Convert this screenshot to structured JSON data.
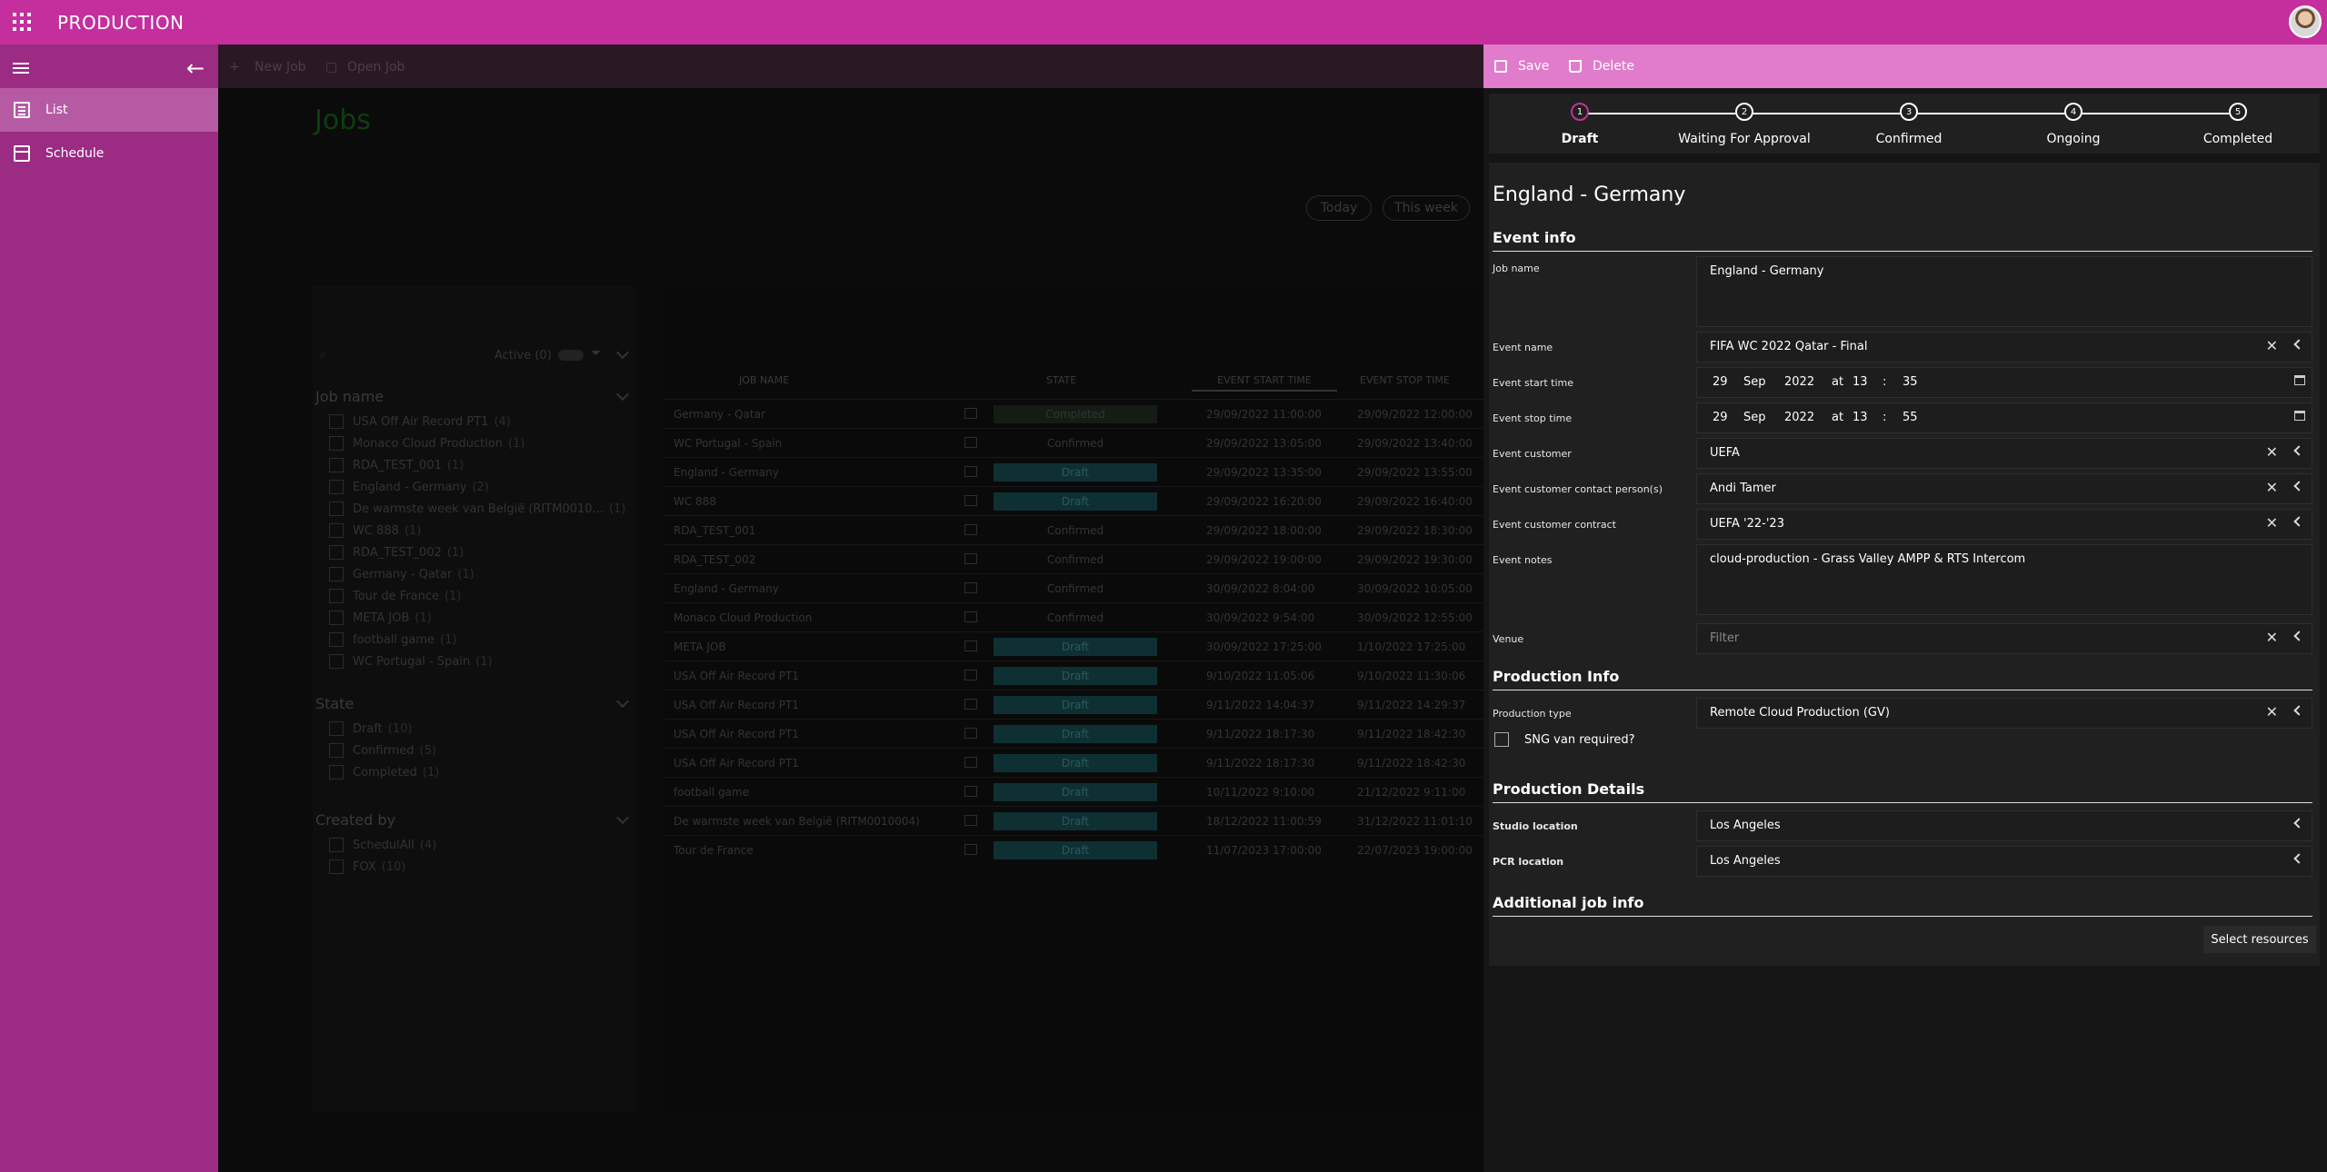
{
  "app": {
    "title": "PRODUCTION"
  },
  "sidebar": {
    "items": [
      {
        "label": "List",
        "icon": "list-icon",
        "active": true
      },
      {
        "label": "Schedule",
        "icon": "calendar-icon",
        "active": false
      }
    ]
  },
  "main": {
    "commands": {
      "new_job": "New Job",
      "open_job": "Open Job"
    },
    "title": "Jobs",
    "pills": {
      "today": "Today",
      "this_week": "This week"
    },
    "filters": {
      "active_label": "Active (0)",
      "groups": [
        {
          "title": "Job name",
          "items": [
            {
              "label": "USA Off Air Record PT1",
              "count": "(4)"
            },
            {
              "label": "Monaco Cloud Production",
              "count": "(1)"
            },
            {
              "label": "RDA_TEST_001",
              "count": "(1)"
            },
            {
              "label": "England - Germany",
              "count": "(2)"
            },
            {
              "label": "De warmste week van België (RITM0010...",
              "count": "(1)"
            },
            {
              "label": "WC 888",
              "count": "(1)"
            },
            {
              "label": "RDA_TEST_002",
              "count": "(1)"
            },
            {
              "label": "Germany - Qatar",
              "count": "(1)"
            },
            {
              "label": "Tour de France",
              "count": "(1)"
            },
            {
              "label": "META JOB",
              "count": "(1)"
            },
            {
              "label": "football game",
              "count": "(1)"
            },
            {
              "label": "WC Portugal - Spain",
              "count": "(1)"
            }
          ]
        },
        {
          "title": "State",
          "items": [
            {
              "label": "Draft",
              "count": "(10)"
            },
            {
              "label": "Confirmed",
              "count": "(5)"
            },
            {
              "label": "Completed",
              "count": "(1)"
            }
          ]
        },
        {
          "title": "Created by",
          "items": [
            {
              "label": "SchedulAll",
              "count": "(4)"
            },
            {
              "label": "FOX",
              "count": "(10)"
            }
          ]
        }
      ]
    },
    "grid": {
      "headers": {
        "job_name": "JOB NAME",
        "state": "STATE",
        "start": "EVENT START TIME",
        "stop": "EVENT STOP TIME"
      },
      "rows": [
        {
          "name": "Germany - Qatar",
          "state": "Completed",
          "start": "29/09/2022 11:00:00",
          "stop": "29/09/2022 12:00:00"
        },
        {
          "name": "WC Portugal - Spain",
          "state": "Confirmed",
          "start": "29/09/2022 13:05:00",
          "stop": "29/09/2022 13:40:00"
        },
        {
          "name": "England - Germany",
          "state": "Draft",
          "start": "29/09/2022 13:35:00",
          "stop": "29/09/2022 13:55:00"
        },
        {
          "name": "WC 888",
          "state": "Draft",
          "start": "29/09/2022 16:20:00",
          "stop": "29/09/2022 16:40:00"
        },
        {
          "name": "RDA_TEST_001",
          "state": "Confirmed",
          "start": "29/09/2022 18:00:00",
          "stop": "29/09/2022 18:30:00"
        },
        {
          "name": "RDA_TEST_002",
          "state": "Confirmed",
          "start": "29/09/2022 19:00:00",
          "stop": "29/09/2022 19:30:00"
        },
        {
          "name": "England - Germany",
          "state": "Confirmed",
          "start": "30/09/2022 8:04:00",
          "stop": "30/09/2022 10:05:00"
        },
        {
          "name": "Monaco Cloud Production",
          "state": "Confirmed",
          "start": "30/09/2022 9:54:00",
          "stop": "30/09/2022 12:55:00"
        },
        {
          "name": "META JOB",
          "state": "Draft",
          "start": "30/09/2022 17:25:00",
          "stop": "1/10/2022 17:25:00"
        },
        {
          "name": "USA Off Air Record PT1",
          "state": "Draft",
          "start": "9/10/2022 11:05:06",
          "stop": "9/10/2022 11:30:06"
        },
        {
          "name": "USA Off Air Record PT1",
          "state": "Draft",
          "start": "9/11/2022 14:04:37",
          "stop": "9/11/2022 14:29:37"
        },
        {
          "name": "USA Off Air Record PT1",
          "state": "Draft",
          "start": "9/11/2022 18:17:30",
          "stop": "9/11/2022 18:42:30"
        },
        {
          "name": "USA Off Air Record PT1",
          "state": "Draft",
          "start": "9/11/2022 18:17:30",
          "stop": "9/11/2022 18:42:30"
        },
        {
          "name": "football game",
          "state": "Draft",
          "start": "10/11/2022 9:10:00",
          "stop": "21/12/2022 9:11:00"
        },
        {
          "name": "De warmste week van België (RITM0010004)",
          "state": "Draft",
          "start": "18/12/2022 11:00:59",
          "stop": "31/12/2022 11:01:10"
        },
        {
          "name": "Tour de France",
          "state": "Draft",
          "start": "11/07/2023 17:00:00",
          "stop": "22/07/2023 19:00:00"
        }
      ]
    }
  },
  "panel": {
    "commands": {
      "save": "Save",
      "delete": "Delete"
    },
    "steps": [
      {
        "num": "1",
        "label": "Draft",
        "current": true
      },
      {
        "num": "2",
        "label": "Waiting For Approval"
      },
      {
        "num": "3",
        "label": "Confirmed"
      },
      {
        "num": "4",
        "label": "Ongoing"
      },
      {
        "num": "5",
        "label": "Completed"
      }
    ],
    "title": "England - Germany",
    "sections": {
      "event_info": "Event info",
      "production_info": "Production Info",
      "production_details": "Production Details",
      "additional": "Additional job info"
    },
    "fields": {
      "job_name": {
        "label": "Job name",
        "value": "England - Germany"
      },
      "event_name": {
        "label": "Event name",
        "value": "FIFA WC 2022 Qatar - Final"
      },
      "start": {
        "label": "Event start time",
        "day": "29",
        "month": "Sep",
        "year": "2022",
        "at": "at",
        "hour": "13",
        "sep": ":",
        "minute": "35"
      },
      "stop": {
        "label": "Event stop time",
        "day": "29",
        "month": "Sep",
        "year": "2022",
        "at": "at",
        "hour": "13",
        "sep": ":",
        "minute": "55"
      },
      "customer": {
        "label": "Event customer",
        "value": "UEFA"
      },
      "contact": {
        "label": "Event customer contact person(s)",
        "value": "Andi Tamer"
      },
      "contract": {
        "label": "Event customer contract",
        "value": "UEFA '22-'23"
      },
      "notes": {
        "label": "Event notes",
        "value": "cloud-production - Grass Valley AMPP & RTS Intercom"
      },
      "venue": {
        "label": "Venue",
        "placeholder": "Filter"
      },
      "production_type": {
        "label": "Production type",
        "value": "Remote Cloud Production (GV)"
      },
      "sng": {
        "label": "SNG van required?"
      },
      "studio": {
        "label": "Studio location",
        "value": "Los Angeles"
      },
      "pcr": {
        "label": "PCR location",
        "value": "Los Angeles"
      }
    },
    "select_resources": "Select resources"
  },
  "colors": {
    "brand": "#c42f9d",
    "sidebar": "#9c2b83",
    "panel_bar": "#e07ccb"
  }
}
